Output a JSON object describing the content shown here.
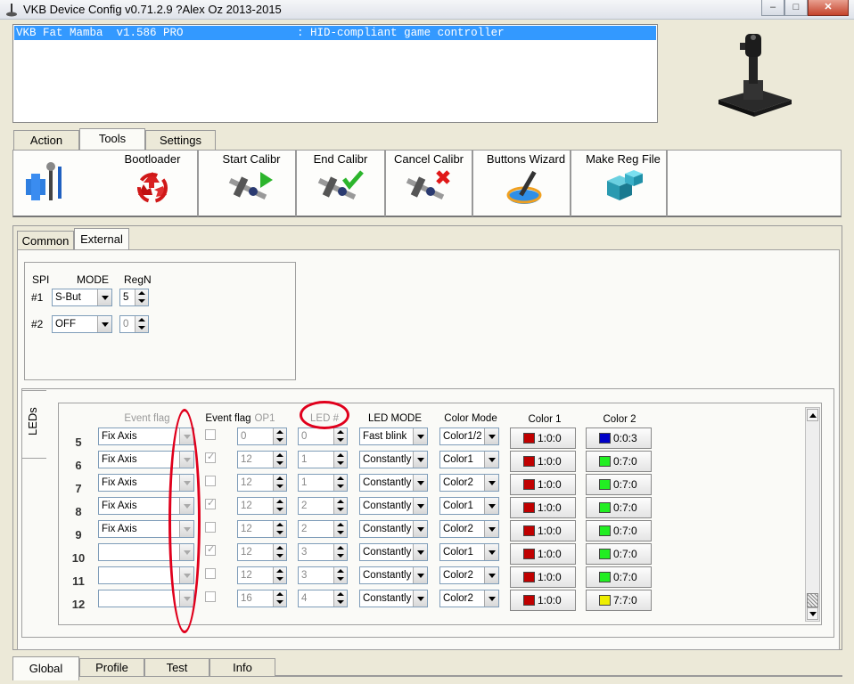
{
  "window": {
    "title": "VKB Device Config v0.71.2.9 ?Alex Oz 2013-2015"
  },
  "window_controls": {
    "minimize": "–",
    "maximize": "□",
    "close": "✕"
  },
  "device_list": {
    "row": "VKB Fat Mamba  v1.586 PRO                 : HID-compliant game controller"
  },
  "top_tabs": [
    "Action",
    "Tools",
    "Settings"
  ],
  "toolbar": {
    "bootloader": "Bootloader",
    "start_calibr": "Start Calibr",
    "end_calibr": "End Calibr",
    "cancel_calibr": "Cancel Calibr",
    "buttons_wizard": "Buttons Wizard",
    "make_reg_file": "Make Reg File"
  },
  "sub_tabs": [
    "Common",
    "External"
  ],
  "spi": {
    "col_spi": "SPI",
    "col_mode": "MODE",
    "col_regn": "RegN",
    "rows": [
      {
        "label": "#1",
        "mode": "S-But",
        "regn": "5"
      },
      {
        "label": "#2",
        "mode": "OFF",
        "regn": "0"
      }
    ]
  },
  "leds_tab": "LEDs",
  "led_headers": {
    "event_flag_dd": "Event flag",
    "event_flag_chk": "Event flag",
    "op1": "OP1",
    "led_num": "LED #",
    "led_mode": "LED MODE",
    "color_mode": "Color Mode",
    "color1": "Color 1",
    "color2": "Color 2"
  },
  "led_rows": [
    {
      "num": "5",
      "event": "Fix Axis",
      "checked": false,
      "op1": "0",
      "led": "0",
      "mode": "Fast blink",
      "cmode": "Color1/2",
      "c1": "1:0:0",
      "c1color": "#c00000",
      "c2": "0:0:3",
      "c2color": "#0000c8"
    },
    {
      "num": "6",
      "event": "Fix Axis",
      "checked": true,
      "op1": "12",
      "led": "1",
      "mode": "Constantly",
      "cmode": "Color1",
      "c1": "1:0:0",
      "c1color": "#c00000",
      "c2": "0:7:0",
      "c2color": "#22ee22"
    },
    {
      "num": "7",
      "event": "Fix Axis",
      "checked": false,
      "op1": "12",
      "led": "1",
      "mode": "Constantly",
      "cmode": "Color2",
      "c1": "1:0:0",
      "c1color": "#c00000",
      "c2": "0:7:0",
      "c2color": "#22ee22"
    },
    {
      "num": "8",
      "event": "Fix Axis",
      "checked": true,
      "op1": "12",
      "led": "2",
      "mode": "Constantly",
      "cmode": "Color1",
      "c1": "1:0:0",
      "c1color": "#c00000",
      "c2": "0:7:0",
      "c2color": "#22ee22"
    },
    {
      "num": "9",
      "event": "Fix Axis",
      "checked": false,
      "op1": "12",
      "led": "2",
      "mode": "Constantly",
      "cmode": "Color2",
      "c1": "1:0:0",
      "c1color": "#c00000",
      "c2": "0:7:0",
      "c2color": "#22ee22"
    },
    {
      "num": "10",
      "event": "",
      "checked": true,
      "op1": "12",
      "led": "3",
      "mode": "Constantly",
      "cmode": "Color1",
      "c1": "1:0:0",
      "c1color": "#c00000",
      "c2": "0:7:0",
      "c2color": "#22ee22"
    },
    {
      "num": "11",
      "event": "",
      "checked": false,
      "op1": "12",
      "led": "3",
      "mode": "Constantly",
      "cmode": "Color2",
      "c1": "1:0:0",
      "c1color": "#c00000",
      "c2": "0:7:0",
      "c2color": "#22ee22"
    },
    {
      "num": "12",
      "event": "",
      "checked": false,
      "op1": "16",
      "led": "4",
      "mode": "Constantly",
      "cmode": "Color2",
      "c1": "1:0:0",
      "c1color": "#c00000",
      "c2": "7:7:0",
      "c2color": "#eeee00"
    }
  ],
  "bottom_tabs": [
    "Global",
    "Profile",
    "Test",
    "Info"
  ]
}
